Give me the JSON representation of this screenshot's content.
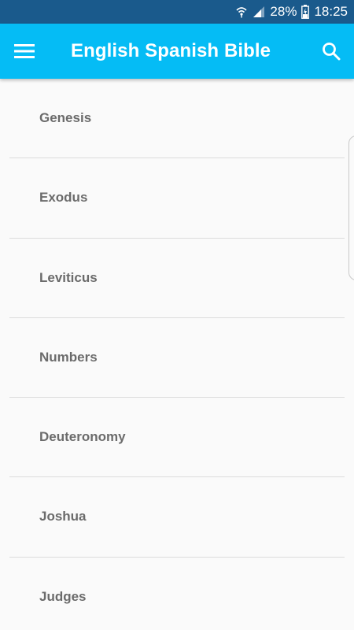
{
  "status_bar": {
    "battery_percent": "28%",
    "time": "18:25",
    "icons": [
      "wifi-icon",
      "signal-icon",
      "battery-icon"
    ]
  },
  "app_bar": {
    "title": "English Spanish Bible",
    "menu_icon": "hamburger-menu-icon",
    "search_icon": "search-icon"
  },
  "colors": {
    "status_bar": "#1a5a8c",
    "app_bar": "#05bcf5",
    "background": "#fafafa",
    "item_text": "#6b6b6b"
  },
  "books": [
    {
      "label": "Genesis"
    },
    {
      "label": "Exodus"
    },
    {
      "label": "Leviticus"
    },
    {
      "label": "Numbers"
    },
    {
      "label": "Deuteronomy"
    },
    {
      "label": "Joshua"
    },
    {
      "label": "Judges"
    }
  ]
}
